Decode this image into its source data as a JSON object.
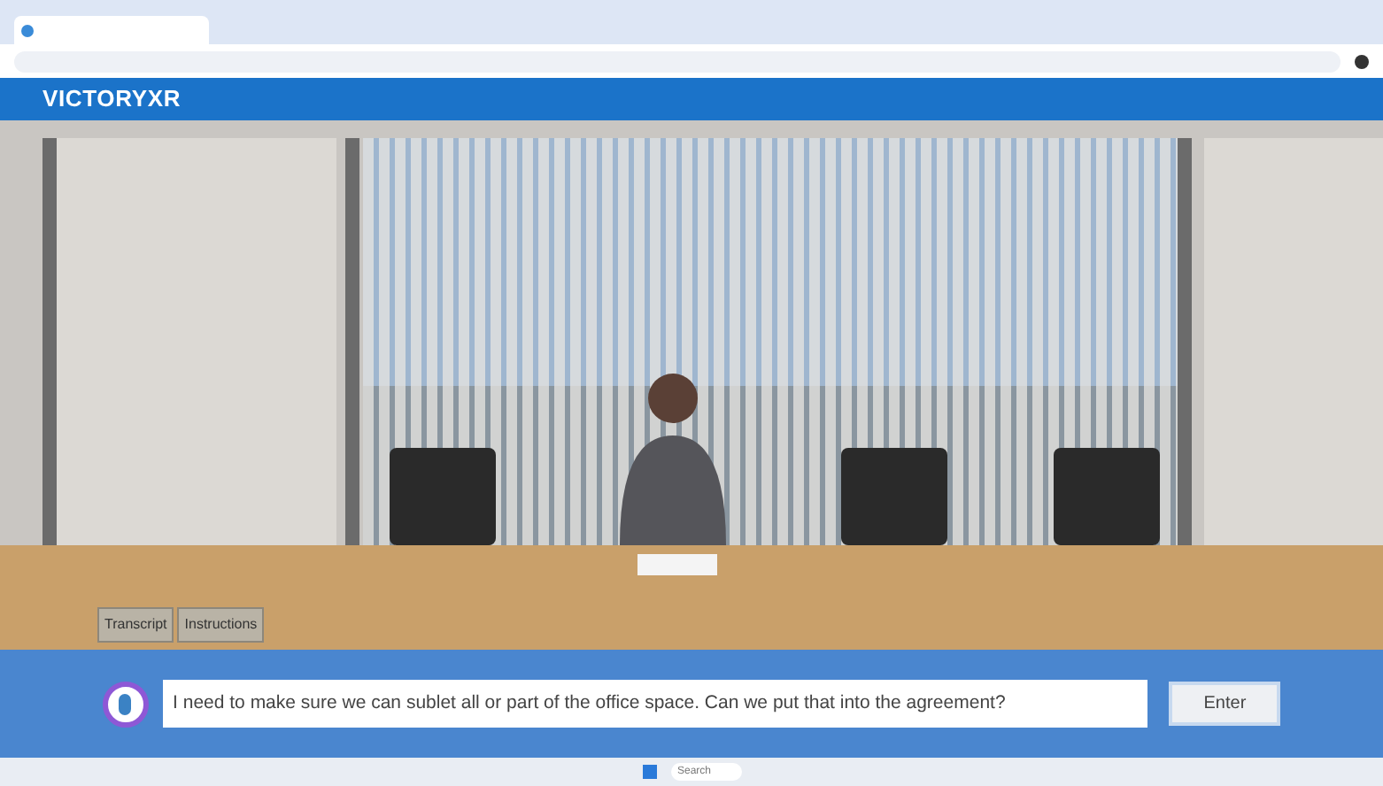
{
  "header": {
    "logo": "VICTORYXR"
  },
  "scene_buttons": [
    {
      "label": "Transcript"
    },
    {
      "label": "Instructions"
    }
  ],
  "input_bar": {
    "value": "I need to make sure we can sublet all or part of the office space. Can we put that into the agreement?",
    "button": "Enter"
  },
  "taskbar": {
    "search_placeholder": "Search"
  }
}
